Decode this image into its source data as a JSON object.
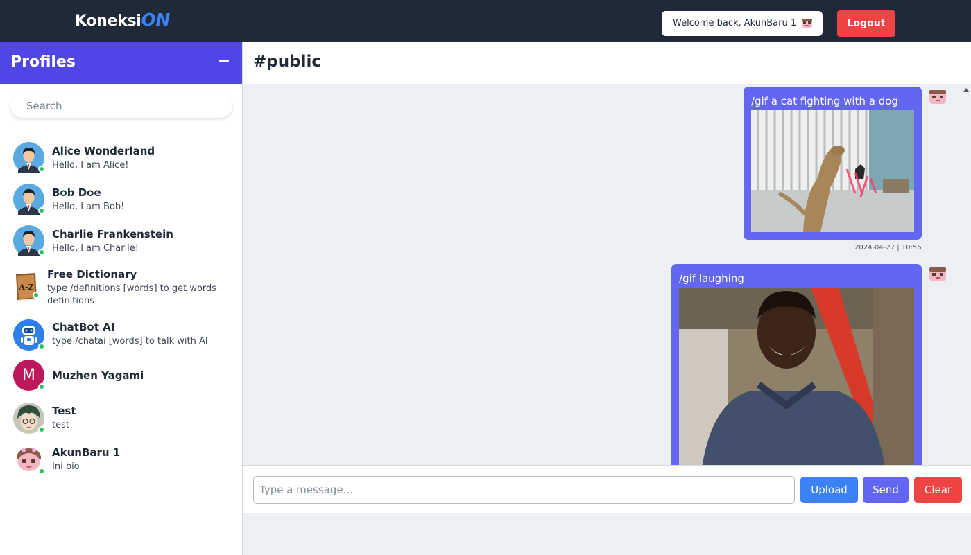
{
  "app": {
    "logo_main": "Koneksi",
    "logo_accent": "ON",
    "welcome_text": "Welcome back, AkunBaru 1",
    "logout_label": "Logout"
  },
  "sidebar": {
    "title": "Profiles",
    "search_placeholder": "Search",
    "profiles": [
      {
        "name": "Alice Wonderland",
        "bio": "Hello, I am Alice!",
        "avatar": "man-suit-icon",
        "online": true
      },
      {
        "name": "Bob Doe",
        "bio": "Hello, I am Bob!",
        "avatar": "man-suit-icon",
        "online": true
      },
      {
        "name": "Charlie Frankenstein",
        "bio": "Hello, I am Charlie!",
        "avatar": "man-suit-icon",
        "online": true
      },
      {
        "name": "Free Dictionary",
        "bio": "type /definitions [words] to get words definitions",
        "avatar": "dictionary-book-icon",
        "online": true
      },
      {
        "name": "ChatBot AI",
        "bio": "type /chatai [words] to talk with AI",
        "avatar": "robot-icon",
        "online": true
      },
      {
        "name": "Muzhen Yagami",
        "bio": "",
        "avatar_letter": "M",
        "avatar_color": "#be185d",
        "online": true
      },
      {
        "name": "Test",
        "bio": "test",
        "avatar": "anime-character-icon",
        "online": true
      },
      {
        "name": "AkunBaru 1",
        "bio": "Ini bio",
        "avatar": "pink-character-icon",
        "online": true
      }
    ]
  },
  "channel": {
    "name": "#public"
  },
  "messages": [
    {
      "text": "/gif a cat fighting with a dog",
      "media": "gif-cat-dog-image",
      "timestamp": "2024-04-27 | 10:56"
    },
    {
      "text": "/gif laughing",
      "media": "gif-laughing-man-image",
      "timestamp": ""
    }
  ],
  "composer": {
    "placeholder": "Type a message...",
    "upload_label": "Upload",
    "send_label": "Send",
    "clear_label": "Clear"
  },
  "colors": {
    "topbar": "#1f2937",
    "brand_accent": "#3b82f6",
    "sidebar_header": "#4f46e5",
    "bubble": "#6366f1",
    "danger": "#ef4444",
    "online": "#22c55e"
  }
}
